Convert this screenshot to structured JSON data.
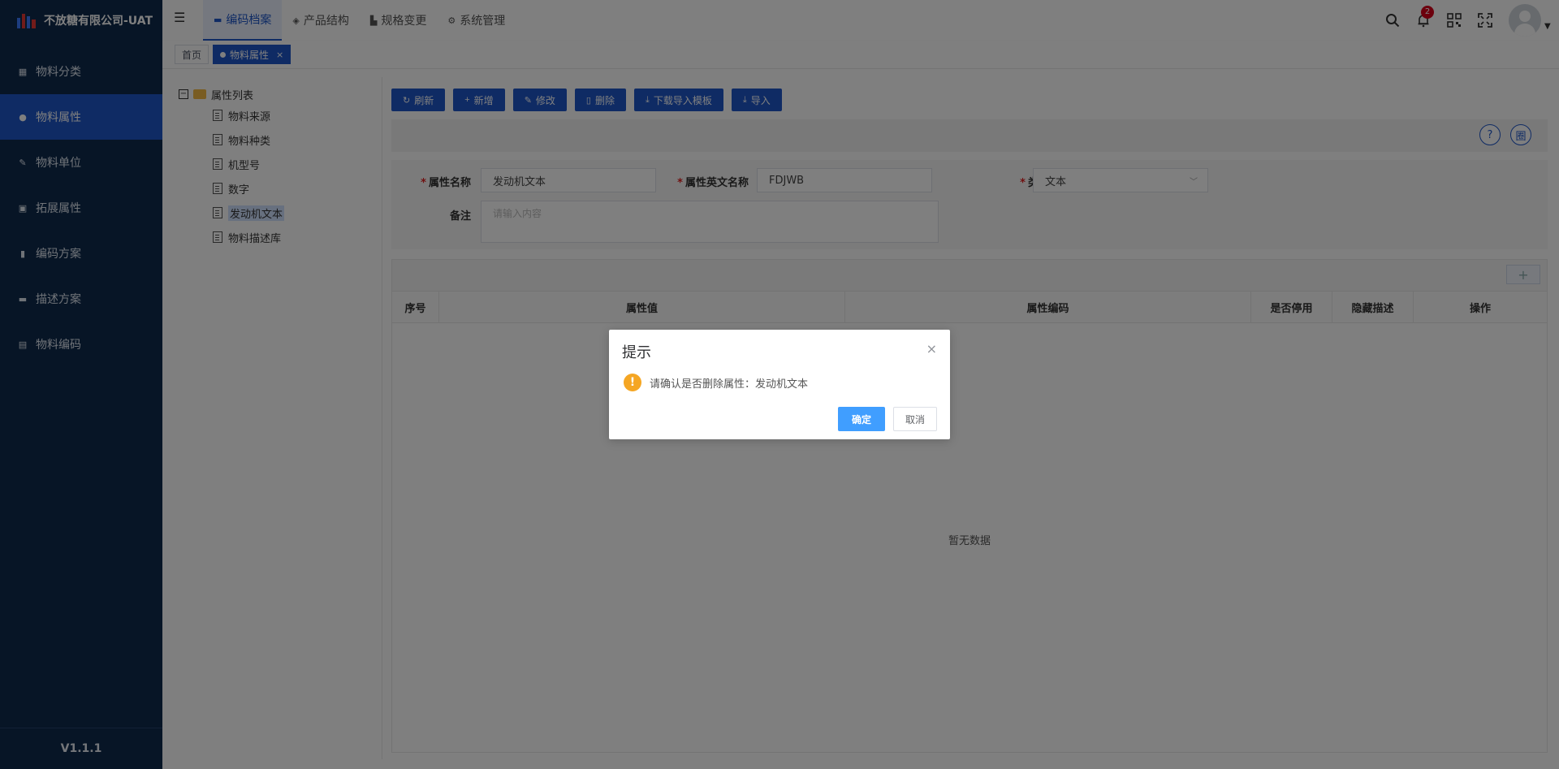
{
  "brand": {
    "title": "不放糖有限公司-UAT",
    "accent": "#1f57c9"
  },
  "sidebar": {
    "items": [
      {
        "label": "物料分类",
        "icon": "grid-icon"
      },
      {
        "label": "物料属性",
        "icon": "info-icon",
        "active": true
      },
      {
        "label": "物料单位",
        "icon": "pencil-icon"
      },
      {
        "label": "拓展属性",
        "icon": "image-icon"
      },
      {
        "label": "编码方案",
        "icon": "book-icon"
      },
      {
        "label": "描述方案",
        "icon": "monitor-icon"
      },
      {
        "label": "物料编码",
        "icon": "document-icon"
      }
    ],
    "version": "V1.1.1"
  },
  "topnav": {
    "items": [
      {
        "label": "编码档案",
        "active": true
      },
      {
        "label": "产品结构"
      },
      {
        "label": "规格变更"
      },
      {
        "label": "系统管理"
      }
    ]
  },
  "header": {
    "notification_count": "2"
  },
  "tabs": {
    "home": "首页",
    "active": "物料属性",
    "close": "×"
  },
  "tree": {
    "root": "属性列表",
    "toggle": "−",
    "children": [
      "物料来源",
      "物料种类",
      "机型号",
      "数字",
      "发动机文本",
      "物料描述库"
    ],
    "selected_index": 4
  },
  "toolbar": {
    "refresh": "刷新",
    "add": "新增",
    "edit": "修改",
    "delete": "删除",
    "download": "下载导入模板",
    "import": "导入"
  },
  "help_buttons": {
    "help": "?",
    "settings": "圈"
  },
  "form": {
    "required_mark": "*",
    "name_label": "属性名称",
    "name_value": "发动机文本",
    "en_label": "属性英文名称",
    "en_value": "FDJWB",
    "type_label": "类型",
    "type_value": "文本",
    "remark_label": "备注",
    "remark_placeholder": "请输入内容"
  },
  "grid": {
    "add": "+",
    "columns": [
      "序号",
      "属性值",
      "属性编码",
      "是否停用",
      "隐藏描述",
      "操作"
    ],
    "empty": "暂无数据"
  },
  "dialog": {
    "title": "提示",
    "close": "×",
    "message": "请确认是否删除属性：发动机文本",
    "ok": "确定",
    "cancel": "取消"
  }
}
